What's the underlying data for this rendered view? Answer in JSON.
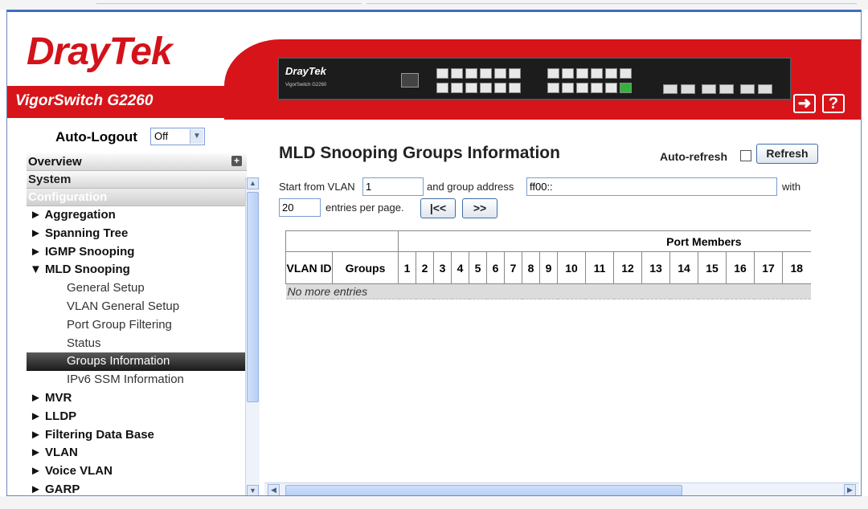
{
  "header": {
    "logo_a": "Dray",
    "logo_b": "Tek",
    "product": "VigorSwitch G2260",
    "device_brand": "DrayTek",
    "device_model": "VigorSwitch G2260",
    "logout_symbol": "➜",
    "help_symbol": "?"
  },
  "nav": {
    "autologout_label": "Auto-Logout",
    "autologout_value": "Off",
    "overview": "Overview",
    "system": "System",
    "configuration": "Configuration",
    "items": [
      {
        "label": "► Aggregation"
      },
      {
        "label": "► Spanning Tree"
      },
      {
        "label": "► IGMP Snooping"
      },
      {
        "label": "▼ MLD Snooping"
      }
    ],
    "mld_sub": [
      {
        "label": "General Setup"
      },
      {
        "label": "VLAN General Setup"
      },
      {
        "label": "Port Group Filtering"
      },
      {
        "label": "Status"
      },
      {
        "label": "Groups Information"
      },
      {
        "label": "IPv6 SSM Information"
      }
    ],
    "items_after": [
      {
        "label": "► MVR"
      },
      {
        "label": "► LLDP"
      },
      {
        "label": "► Filtering Data Base"
      },
      {
        "label": "► VLAN"
      },
      {
        "label": "► Voice VLAN"
      },
      {
        "label": "► GARP"
      }
    ]
  },
  "main": {
    "title": "MLD Snooping Groups Information",
    "auto_refresh_label": "Auto-refresh",
    "refresh_button": "Refresh",
    "start_vlan_label": "Start from VLAN",
    "start_vlan_value": "1",
    "group_addr_label": "and group address",
    "group_addr_value": "ff00::",
    "with_label": "with",
    "entries_value": "20",
    "entries_label": "entries per page.",
    "first_button": "|<<",
    "next_button": ">>"
  },
  "table": {
    "port_members_header": "Port Members",
    "vlan_id_header": "VLAN ID",
    "groups_header": "Groups",
    "ports": [
      "1",
      "2",
      "3",
      "4",
      "5",
      "6",
      "7",
      "8",
      "9",
      "10",
      "11",
      "12",
      "13",
      "14",
      "15",
      "16",
      "17",
      "18"
    ],
    "empty_text": "No more entries"
  }
}
